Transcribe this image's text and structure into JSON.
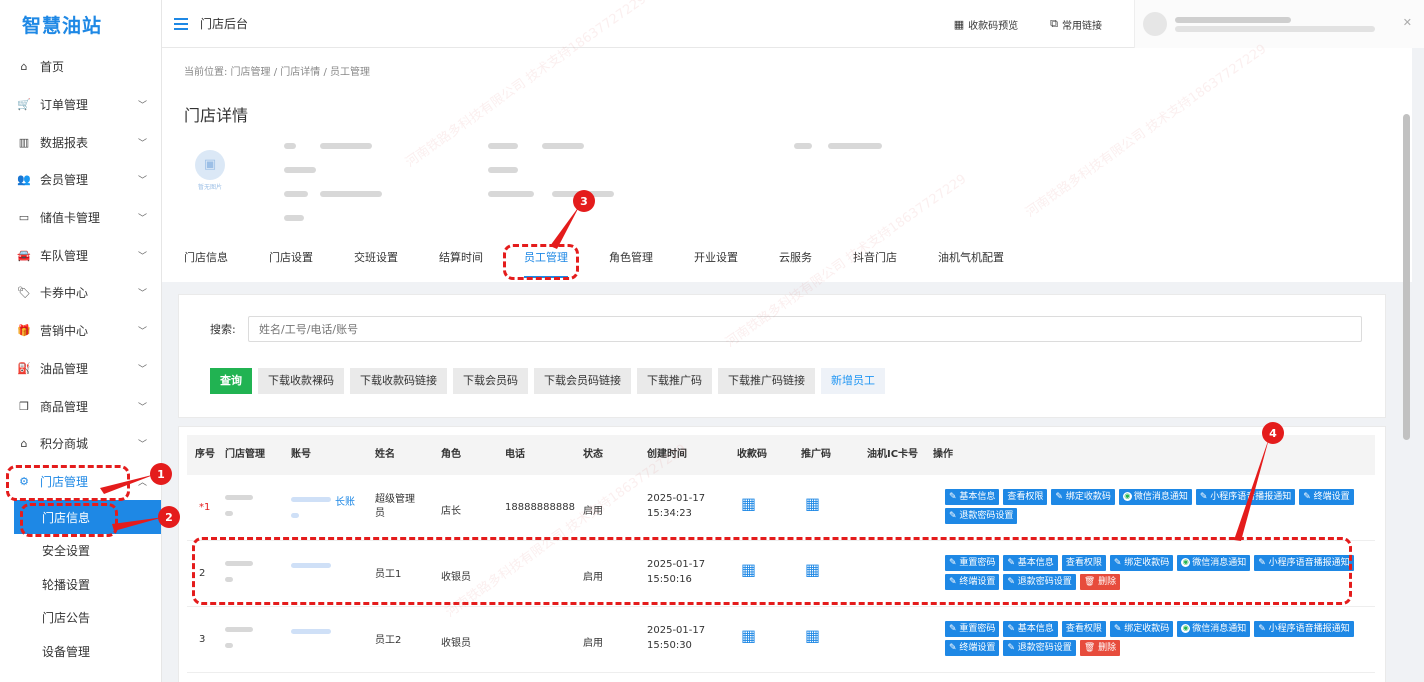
{
  "logo": "智慧油站",
  "header": {
    "title": "门店后台",
    "links": [
      {
        "icon": "qr-preview-icon",
        "label": "收款码预览"
      },
      {
        "icon": "link-icon",
        "label": "常用链接"
      }
    ]
  },
  "sidebar": {
    "items": [
      {
        "icon": "home-icon",
        "label": "首页",
        "chevron": false
      },
      {
        "icon": "cart-icon",
        "label": "订单管理",
        "chevron": true
      },
      {
        "icon": "bar-chart-icon",
        "label": "数据报表",
        "chevron": true
      },
      {
        "icon": "users-icon",
        "label": "会员管理",
        "chevron": true
      },
      {
        "icon": "card-icon",
        "label": "储值卡管理",
        "chevron": true
      },
      {
        "icon": "car-icon",
        "label": "车队管理",
        "chevron": true
      },
      {
        "icon": "tag-icon",
        "label": "卡券中心",
        "chevron": true
      },
      {
        "icon": "gift-icon",
        "label": "营销中心",
        "chevron": true
      },
      {
        "icon": "oil-icon",
        "label": "油品管理",
        "chevron": true
      },
      {
        "icon": "cubes-icon",
        "label": "商品管理",
        "chevron": true
      },
      {
        "icon": "store-icon",
        "label": "积分商城",
        "chevron": true
      },
      {
        "icon": "cog-icon",
        "label": "门店管理",
        "chevron": true,
        "active": true
      }
    ],
    "sub_items": [
      {
        "label": "门店信息",
        "active": true
      },
      {
        "label": "安全设置"
      },
      {
        "label": "轮播设置"
      },
      {
        "label": "门店公告"
      },
      {
        "label": "设备管理"
      }
    ]
  },
  "breadcrumb": "当前位置: 门店管理 / 门店详情 / 员工管理",
  "page_title": "门店详情",
  "store_image_caption": "暂无图片",
  "tabs": [
    "门店信息",
    "门店设置",
    "交班设置",
    "结算时间",
    "员工管理",
    "角色管理",
    "开业设置",
    "云服务",
    "抖音门店",
    "油机气机配置"
  ],
  "active_tab": "员工管理",
  "search": {
    "label": "搜索:",
    "placeholder": "姓名/工号/电话/账号"
  },
  "buttons": {
    "query": "查询",
    "download_payment_code": "下载收款裸码",
    "download_payment_link": "下载收款码链接",
    "download_member_code": "下载会员码",
    "download_member_link": "下载会员码链接",
    "download_promo_code": "下载推广码",
    "download_promo_link": "下载推广码链接",
    "add_employee": "新增员工"
  },
  "table": {
    "headers": [
      "序号",
      "门店管理",
      "账号",
      "姓名",
      "角色",
      "电话",
      "状态",
      "创建时间",
      "收款码",
      "推广码",
      "油机IC卡号",
      "操作"
    ],
    "rows": [
      {
        "index": "*1",
        "account_suffix": "长账",
        "name": "超级管理员",
        "role": "店长",
        "phone": "18888888888",
        "status": "启用",
        "created_date": "2025-01-17",
        "created_time": "15:34:23",
        "ops": [
          {
            "label": "✎ 基本信息"
          },
          {
            "label": "查看权限"
          },
          {
            "label": "✎ 绑定收款码"
          },
          {
            "label": "微信消息通知",
            "wechat": true
          },
          {
            "label": "✎ 小程序语音播报通知"
          },
          {
            "label": "✎ 终端设置"
          },
          {
            "label": "✎ 退款密码设置"
          }
        ]
      },
      {
        "index": "2",
        "name": "员工1",
        "role": "收银员",
        "phone": "",
        "status": "启用",
        "created_date": "2025-01-17",
        "created_time": "15:50:16",
        "ops": [
          {
            "label": "✎ 重置密码"
          },
          {
            "label": "✎ 基本信息"
          },
          {
            "label": "查看权限"
          },
          {
            "label": "✎ 绑定收款码"
          },
          {
            "label": "微信消息通知",
            "wechat": true
          },
          {
            "label": "✎ 小程序语音播报通知"
          },
          {
            "label": "✎ 终端设置"
          },
          {
            "label": "✎ 退款密码设置"
          },
          {
            "label": "🗑 删除",
            "danger": true
          }
        ]
      },
      {
        "index": "3",
        "name": "员工2",
        "role": "收银员",
        "phone": "",
        "status": "启用",
        "created_date": "2025-01-17",
        "created_time": "15:50:30",
        "ops": [
          {
            "label": "✎ 重置密码"
          },
          {
            "label": "✎ 基本信息"
          },
          {
            "label": "查看权限"
          },
          {
            "label": "✎ 绑定收款码"
          },
          {
            "label": "微信消息通知",
            "wechat": true
          },
          {
            "label": "✎ 小程序语音播报通知"
          },
          {
            "label": "✎ 终端设置"
          },
          {
            "label": "✎ 退款密码设置"
          },
          {
            "label": "🗑 删除",
            "danger": true
          }
        ]
      }
    ]
  },
  "annotations": [
    "1",
    "2",
    "3",
    "4"
  ],
  "colors": {
    "primary": "#1e88e5",
    "success": "#21b352",
    "danger": "#e74c3c",
    "annotation": "#e41c1c"
  }
}
